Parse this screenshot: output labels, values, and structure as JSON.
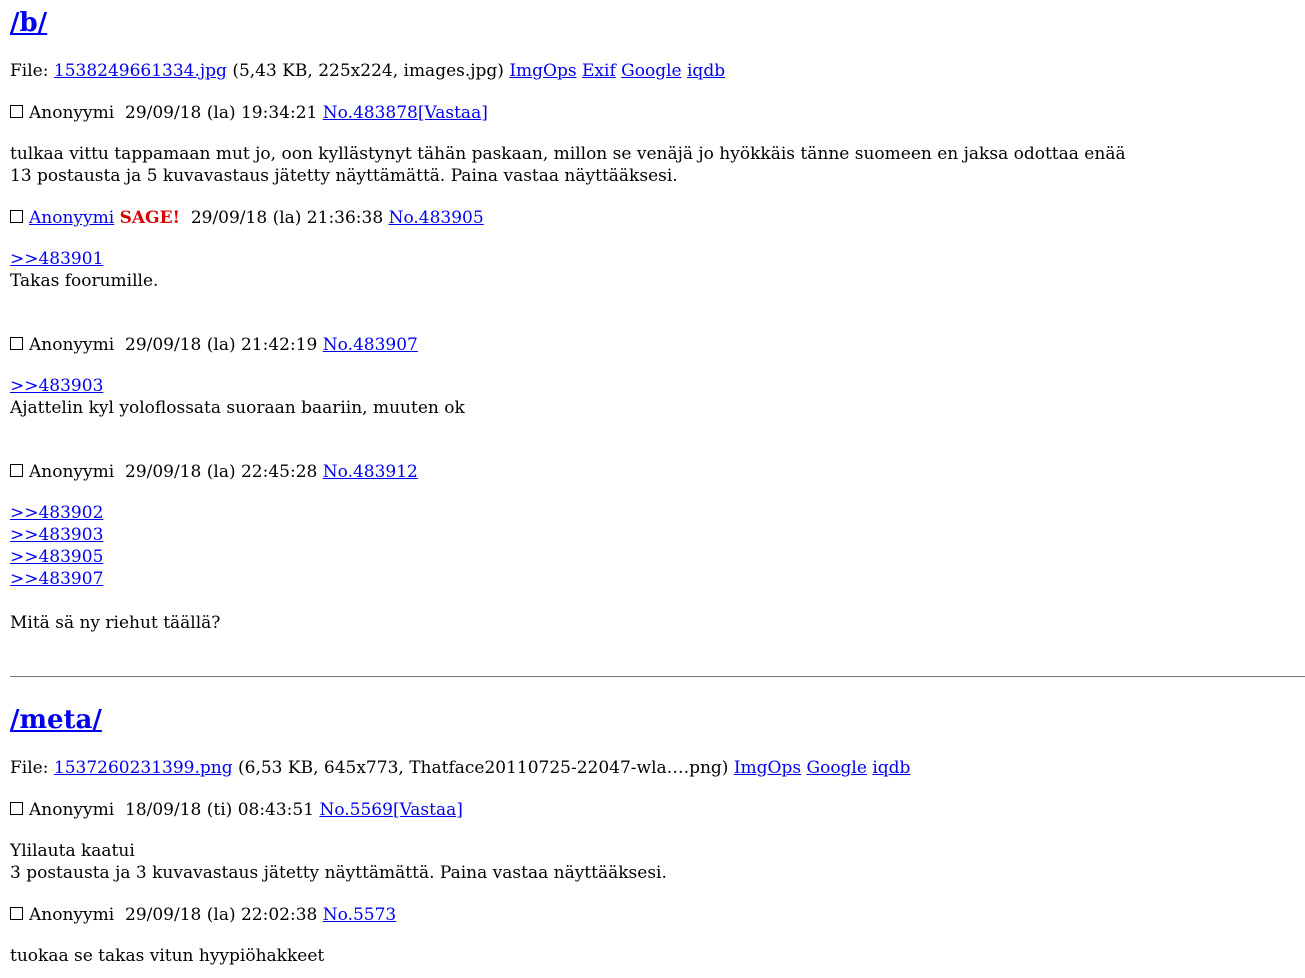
{
  "threads": [
    {
      "board": "/b/",
      "file": {
        "prefix": "File: ",
        "name": "1538249661334.jpg",
        "info": " (5,43 KB, 225x224, images.jpg) ",
        "links": [
          "ImgOps",
          "Exif",
          "Google",
          "iqdb"
        ]
      },
      "op": {
        "author": "Anonyymi",
        "date": "29/09/18 (la) 19:34:21",
        "no": "No.483878",
        "reply": "[Vastaa]",
        "text": "tulkaa vittu tappamaan mut jo, oon kyllästynyt tähän paskaan, millon se venäjä jo hyökkäis tänne suomeen en jaksa odottaa enää",
        "omitted": "13 postausta ja 5 kuvavastaus jätetty näyttämättä. Paina vastaa näyttääksesi."
      },
      "replies": [
        {
          "author": "Anonyymi",
          "sage": "SAGE!",
          "date": "29/09/18 (la) 21:36:38",
          "no": "No.483905",
          "quotes": [
            ">>483901"
          ],
          "text": "Takas foorumille."
        },
        {
          "author": "Anonyymi",
          "date": "29/09/18 (la) 21:42:19",
          "no": "No.483907",
          "quotes": [
            ">>483903"
          ],
          "text": "Ajattelin kyl yoloflossata suoraan baariin, muuten ok"
        },
        {
          "author": "Anonyymi",
          "date": "29/09/18 (la) 22:45:28",
          "no": "No.483912",
          "quotes": [
            ">>483902",
            ">>483903",
            ">>483905",
            ">>483907"
          ],
          "text": "Mitä sä ny riehut täällä?"
        }
      ]
    },
    {
      "board": "/meta/",
      "file": {
        "prefix": "File: ",
        "name": "1537260231399.png",
        "info": " (6,53 KB, 645x773, Thatface20110725-22047-wla….png) ",
        "links": [
          "ImgOps",
          "Google",
          "iqdb"
        ]
      },
      "op": {
        "author": "Anonyymi",
        "date": "18/09/18 (ti) 08:43:51",
        "no": "No.5569",
        "reply": "[Vastaa]",
        "text": "Ylilauta kaatui",
        "omitted": "3 postausta ja 3 kuvavastaus jätetty näyttämättä. Paina vastaa näyttääksesi."
      },
      "replies": [
        {
          "author": "Anonyymi",
          "date": "29/09/18 (la) 22:02:38",
          "no": "No.5573",
          "text": "tuokaa se takas vitun hyypiöhakkeet"
        }
      ]
    }
  ]
}
